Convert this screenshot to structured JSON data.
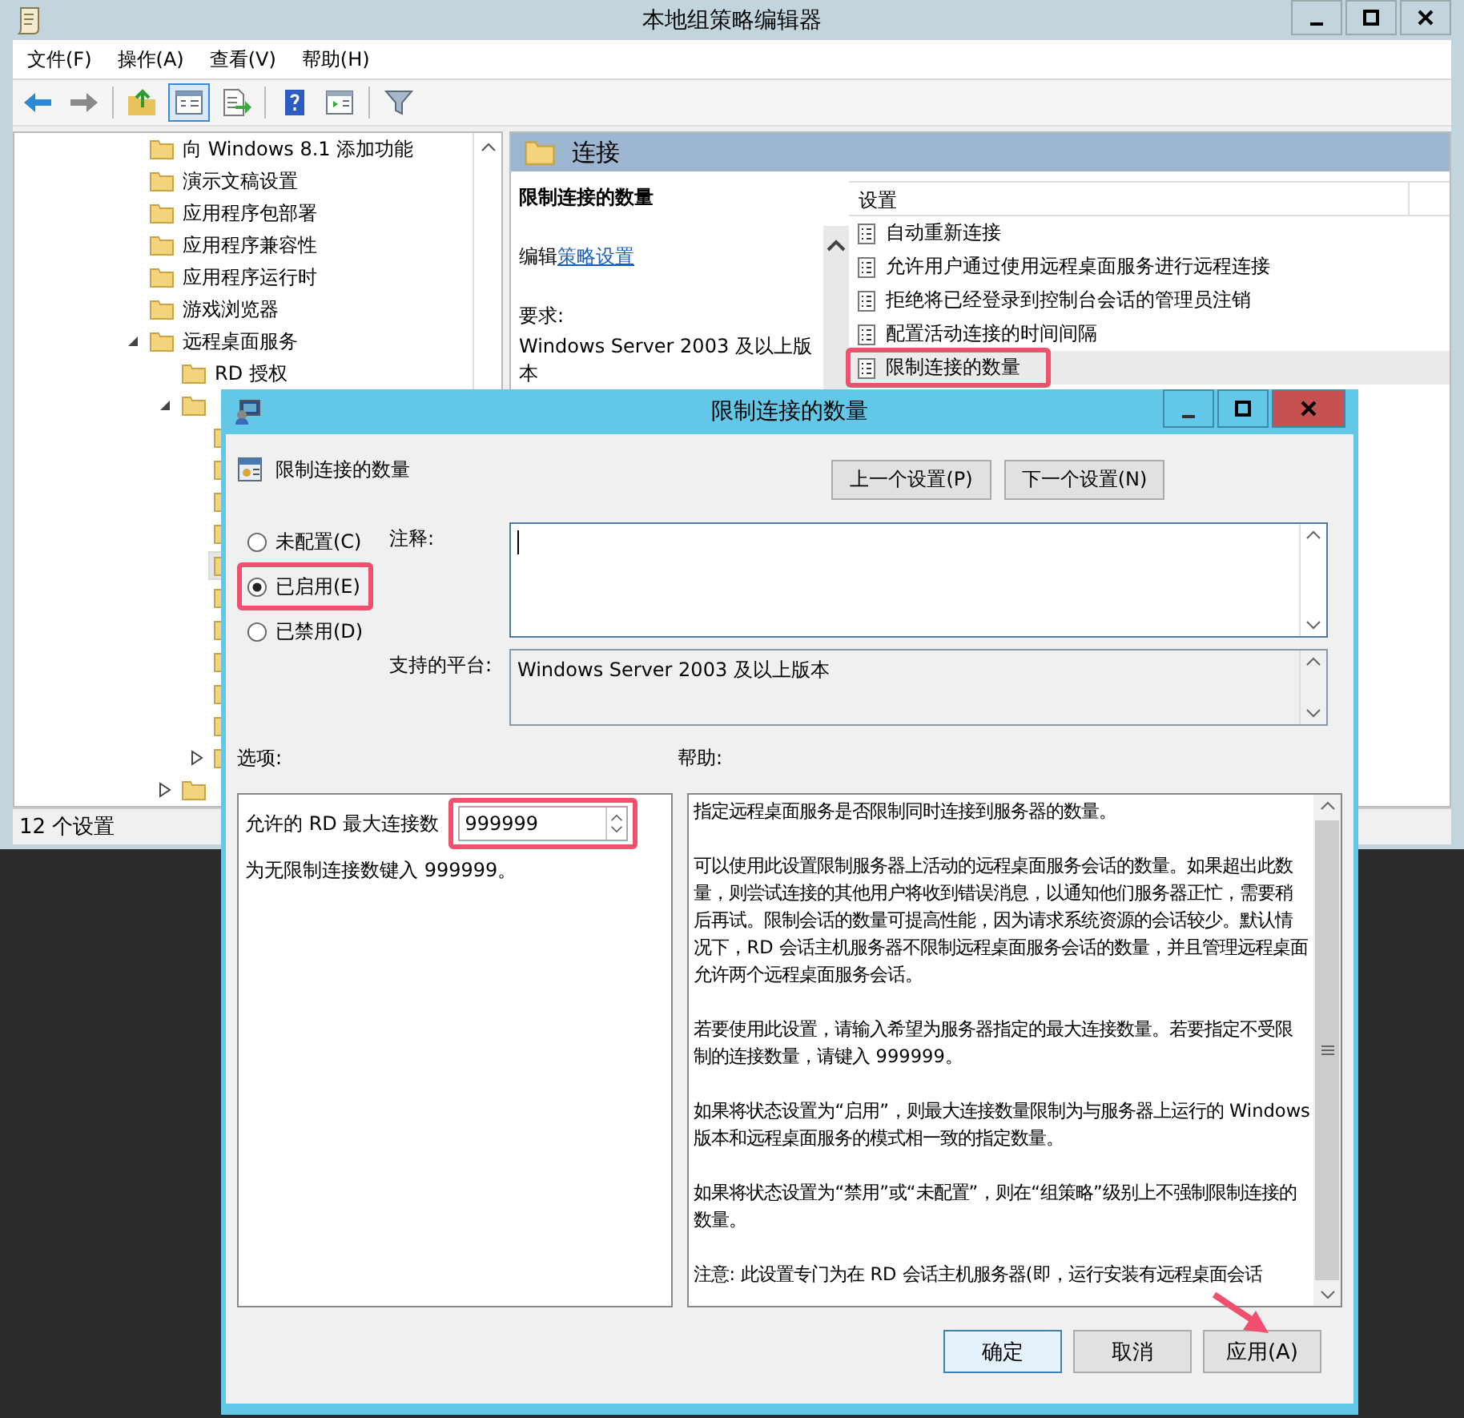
{
  "window": {
    "title": "本地组策略编辑器"
  },
  "menu": [
    "文件(F)",
    "操作(A)",
    "查看(V)",
    "帮助(H)"
  ],
  "tree": [
    {
      "label": "向 Windows 8.1 添加功能",
      "selected": false
    },
    {
      "label": "演示文稿设置",
      "selected": false
    },
    {
      "label": "应用程序包部署",
      "selected": false
    },
    {
      "label": "应用程序兼容性",
      "selected": false
    },
    {
      "label": "应用程序运行时",
      "selected": false
    },
    {
      "label": "游戏浏览器",
      "selected": false
    },
    {
      "label": "远程桌面服务",
      "selected": false,
      "expanded": true,
      "children": [
        {
          "label": "RD 授权",
          "selected": false
        },
        {
          "selected": false,
          "expanded": true,
          "children": [
            {
              "selected": false
            },
            {
              "selected": false
            },
            {
              "selected": false
            },
            {
              "selected": false
            },
            {
              "selected": true
            },
            {
              "selected": false
            },
            {
              "selected": false
            },
            {
              "selected": false
            },
            {
              "selected": false
            },
            {
              "selected": false
            },
            {
              "selected": false,
              "expanded": false
            }
          ]
        },
        {
          "selected": false,
          "expanded": false
        }
      ]
    }
  ],
  "pane": {
    "title": "连接",
    "description": {
      "title": "限制连接的数量",
      "edit_prefix": "编辑",
      "edit_link": "策略设置",
      "requirements_label": "要求:",
      "requirements": "Windows Server 2003 及以上版本"
    },
    "column": "设置",
    "settings": [
      {
        "label": "自动重新连接",
        "selected": false,
        "highlighted": false
      },
      {
        "label": "允许用户通过使用远程桌面服务进行远程连接",
        "selected": false,
        "highlighted": false
      },
      {
        "label": "拒绝将已经登录到控制台会话的管理员注销",
        "selected": false,
        "highlighted": false
      },
      {
        "label": "配置活动连接的时间间隔",
        "selected": false,
        "highlighted": false
      },
      {
        "label": "限制连接的数量",
        "selected": true,
        "highlighted": true
      }
    ]
  },
  "status_bar": "12 个设置",
  "dialog": {
    "title": "限制连接的数量",
    "setting_name": "限制连接的数量",
    "nav_buttons": [
      "上一个设置(P)",
      "下一个设置(N)"
    ],
    "states": [
      {
        "label": "未配置(C)",
        "selected": false,
        "highlighted": false
      },
      {
        "label": "已启用(E)",
        "selected": true,
        "highlighted": true
      },
      {
        "label": "已禁用(D)",
        "selected": false,
        "highlighted": false
      }
    ],
    "comment_label": "注释:",
    "platform_label": "支持的平台:",
    "platform": "Windows Server 2003 及以上版本",
    "options_label": "选项:",
    "help_label": "帮助:",
    "option": {
      "label": "允许的 RD 最大连接数",
      "value": "999999",
      "highlighted": true
    },
    "option_hint": "为无限制连接数键入 999999。",
    "help": [
      "指定远程桌面服务是否限制同时连接到服务器的数量。",
      "可以使用此设置限制服务器上活动的远程桌面服务会话的数量。如果超出此数量，则尝试连接的其他用户将收到错误消息，以通知他们服务器正忙，需要稍后再试。限制会话的数量可提高性能，因为请求系统资源的会话较少。默认情况下，RD 会话主机服务器不限制远程桌面服务会话的数量，并且管理远程桌面允许两个远程桌面服务会话。",
      "若要使用此设置，请输入希望为服务器指定的最大连接数量。若要指定不受限制的连接数量，请键入 999999。",
      "如果将状态设置为“启用”，则最大连接数量限制为与服务器上运行的 Windows 版本和远程桌面服务的模式相一致的指定数量。",
      "如果将状态设置为“禁用”或“未配置”，则在“组策略”级别上不强制限制连接的数量。",
      "注意: 此设置专门为在 RD 会话主机服务器(即，运行安装有远程桌面会话"
    ],
    "buttons": [
      "确定",
      "取消",
      "应用(A)"
    ]
  }
}
